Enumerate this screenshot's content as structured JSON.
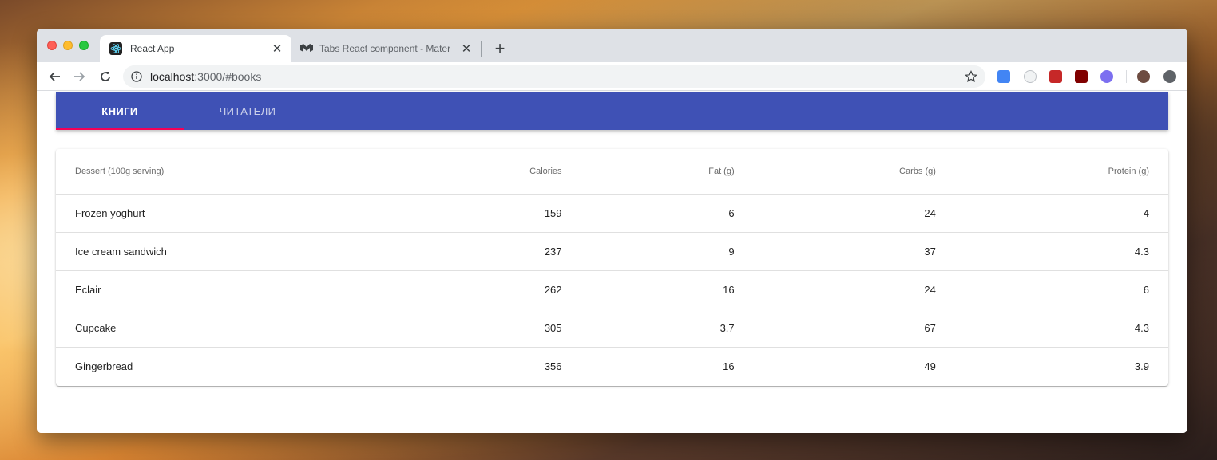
{
  "browser": {
    "tabs": [
      {
        "title": "React App",
        "active": true
      },
      {
        "title": "Tabs React component - Mater",
        "active": false
      }
    ],
    "close_glyph": "✕",
    "new_tab_glyph": "+",
    "url_host": "localhost",
    "url_rest": ":3000/#books"
  },
  "app": {
    "tabs": [
      {
        "label": "КНИГИ",
        "selected": true
      },
      {
        "label": "ЧИТАТЕЛИ",
        "selected": false
      }
    ],
    "accent_color": "#3f51b5",
    "indicator_color": "#f50057"
  },
  "table": {
    "headers": [
      "Dessert (100g serving)",
      "Calories",
      "Fat (g)",
      "Carbs (g)",
      "Protein (g)"
    ],
    "rows": [
      [
        "Frozen yoghurt",
        "159",
        "6",
        "24",
        "4"
      ],
      [
        "Ice cream sandwich",
        "237",
        "9",
        "37",
        "4.3"
      ],
      [
        "Eclair",
        "262",
        "16",
        "24",
        "6"
      ],
      [
        "Cupcake",
        "305",
        "3.7",
        "67",
        "4.3"
      ],
      [
        "Gingerbread",
        "356",
        "16",
        "49",
        "3.9"
      ]
    ]
  }
}
